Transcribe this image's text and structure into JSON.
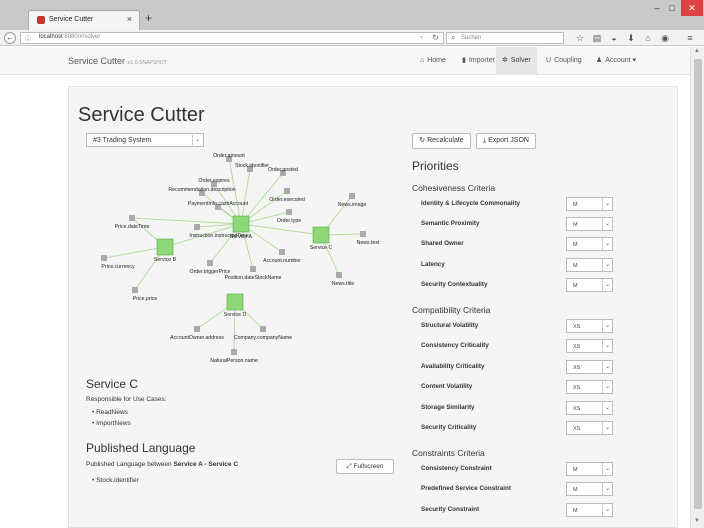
{
  "browser": {
    "tab_title": "Service Cutter",
    "url": "localhost",
    "url_rest": ":8080/#/solver",
    "search_placeholder": "Suchen"
  },
  "app": {
    "brand": "Service Cutter",
    "version": "v1.0-SNAPSHOT",
    "nav": [
      {
        "label": "Home",
        "icon": "home-icon"
      },
      {
        "label": "Importer",
        "icon": "file-icon"
      },
      {
        "label": "Solver",
        "icon": "gear-icon"
      },
      {
        "label": "Coupling",
        "icon": "magnet-icon"
      },
      {
        "label": "Account ▾",
        "icon": "user-icon"
      }
    ]
  },
  "main": {
    "title": "Service Cutter",
    "system_select": "#3 Trading System",
    "recalculate": "Recalculate",
    "export_json": "Export JSON",
    "fullscreen": "Fullscreen"
  },
  "graph": {
    "services": [
      "Service A",
      "Service B",
      "Service C",
      "Service D"
    ],
    "nodes": [
      "Order.amount",
      "Stock.identifier",
      "Order.posted",
      "Order.expires",
      "Recommendation.description",
      "Order.executed",
      "PaymentInfo.cashAccount",
      "Order.type",
      "Price.dateTime",
      "Instruction.instructedTime",
      "Account.number",
      "Price.currency",
      "Order.triggerPrice",
      "Position.dateStockName",
      "Price.price",
      "News.image",
      "News.text",
      "News.title",
      "AccountOwner.address",
      "Company.companyName",
      "NaturalPerson.name"
    ]
  },
  "service_details": {
    "title": "Service C",
    "description": "Responsible for Use Cases:",
    "use_cases": [
      "ReadNews",
      "ImportNews"
    ]
  },
  "published_language": {
    "title": "Published Language",
    "prefix": "Published Language between ",
    "between": "Service A - Service C",
    "items": [
      "Stock.identifier"
    ]
  },
  "priorities": {
    "title": "Priorities",
    "groups": [
      {
        "title": "Cohesiveness Criteria",
        "items": [
          {
            "label": "Identity & Lifecycle Commonality",
            "value": "M"
          },
          {
            "label": "Semantic Proximity",
            "value": "M"
          },
          {
            "label": "Shared Owner",
            "value": "M"
          },
          {
            "label": "Latency",
            "value": "M"
          },
          {
            "label": "Security Contextuality",
            "value": "M"
          }
        ]
      },
      {
        "title": "Compatibility Criteria",
        "items": [
          {
            "label": "Structural Volatility",
            "value": "XS"
          },
          {
            "label": "Consistency Criticality",
            "value": "XS"
          },
          {
            "label": "Availability Criticality",
            "value": "XS"
          },
          {
            "label": "Content Volatility",
            "value": "XS"
          },
          {
            "label": "Storage Similarity",
            "value": "XS"
          },
          {
            "label": "Security Criticality",
            "value": "XS"
          }
        ]
      },
      {
        "title": "Constraints Criteria",
        "items": [
          {
            "label": "Consistency Constraint",
            "value": "M"
          },
          {
            "label": "Predefined Service Constraint",
            "value": "M"
          },
          {
            "label": "Security Constraint",
            "value": "M"
          }
        ]
      }
    ]
  },
  "colors": {
    "service_node": "#8ed87a",
    "service_border": "#5aa845",
    "attr_node": "#aaaaaa",
    "edge": "#b2dd9e"
  }
}
